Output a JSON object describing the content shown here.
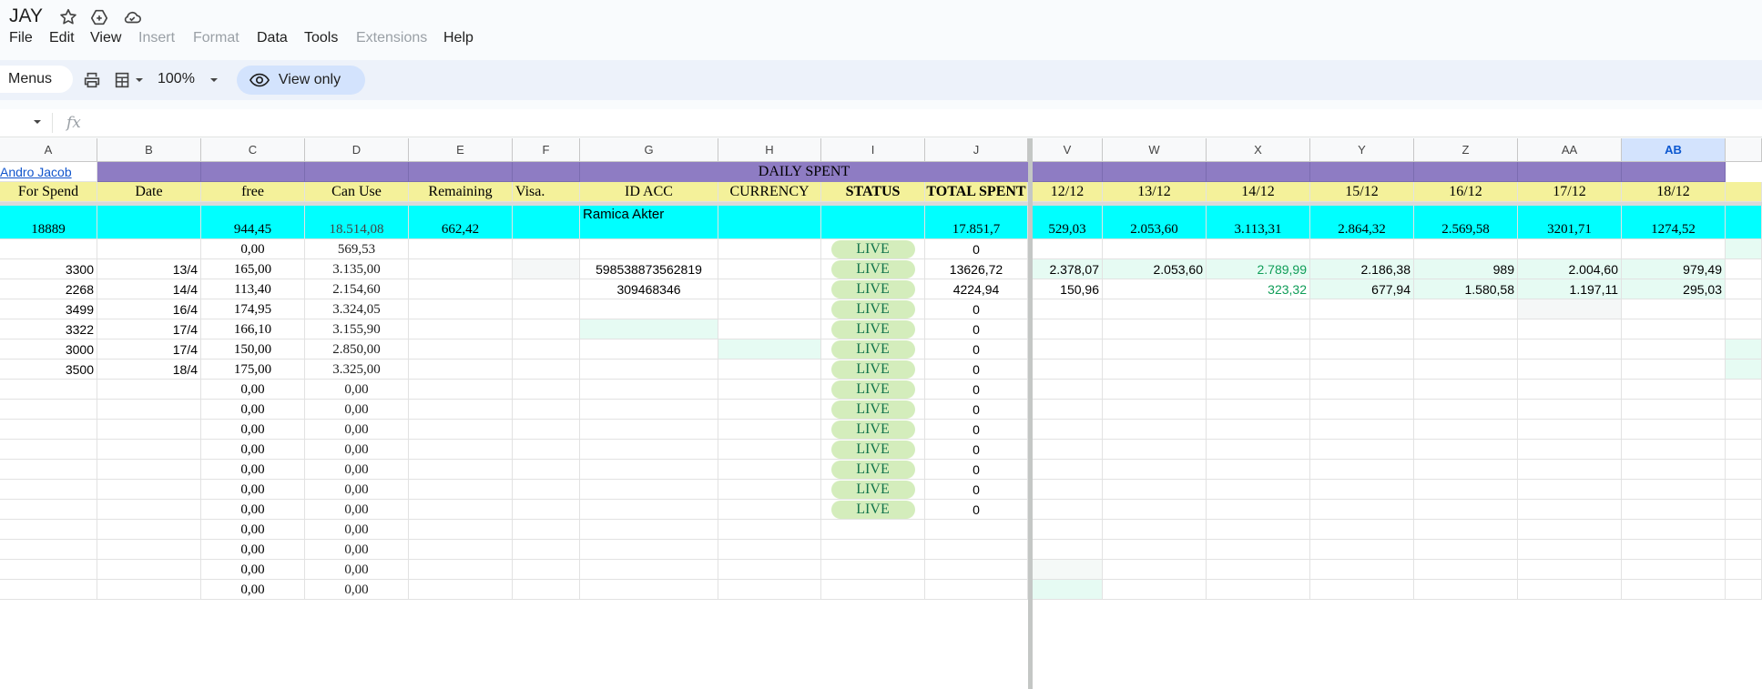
{
  "app": {
    "title": "JAY",
    "menus": [
      "File",
      "Edit",
      "View",
      "Insert",
      "Format",
      "Data",
      "Tools",
      "Extensions",
      "Help"
    ],
    "disabled_menus": [
      "Insert",
      "Format",
      "Extensions"
    ]
  },
  "toolbar": {
    "menus_label": "Menus",
    "zoom": "100%",
    "view_only_label": "View only"
  },
  "formula_bar": {
    "fx": "fx",
    "name_box": ""
  },
  "colors": {
    "purple": "#8e7cc3",
    "yellow": "#f4f19a",
    "cyan": "#00ffff",
    "mint": "#e6fbf3",
    "live_bg": "#d4edbc",
    "live_fg": "#11734b",
    "green_text": "#0f9d58"
  },
  "columns": [
    "A",
    "B",
    "C",
    "D",
    "E",
    "F",
    "G",
    "H",
    "I",
    "J",
    "V",
    "W",
    "X",
    "Y",
    "Z",
    "AA",
    "AB",
    ""
  ],
  "selected_column": "AB",
  "sheet": {
    "link_name": "Andro Jacob",
    "banner": "DAILY SPENT",
    "headers": [
      "For Spend",
      "Date",
      "free",
      "Can Use",
      "Remaining",
      "Visa.",
      "ID ACC",
      "CURRENCY",
      "STATUS",
      "TOTAL SPENT",
      "12/12",
      "13/12",
      "14/12",
      "15/12",
      "16/12",
      "17/12",
      "18/12"
    ],
    "totals": [
      "18889",
      "",
      "944,45",
      "18.514,08",
      "662,42",
      "",
      "Ramica Akter",
      "",
      "",
      "17.851,7",
      "529,03",
      "2.053,60",
      "3.113,31",
      "2.864,32",
      "2.569,58",
      "3201,71",
      "1274,52"
    ],
    "rows": [
      [
        "",
        "",
        "0,00",
        "569,53",
        "",
        "",
        "",
        "",
        "LIVE",
        "0",
        "",
        "",
        "",
        "",
        "",
        "",
        ""
      ],
      [
        "3300",
        "13/4",
        "165,00",
        "3.135,00",
        "",
        "",
        "598538873562819",
        "",
        "LIVE",
        "13626,72",
        "2.378,07",
        "2.053,60",
        "2.789,99",
        "2.186,38",
        "989",
        "2.004,60",
        "979,49"
      ],
      [
        "2268",
        "14/4",
        "113,40",
        "2.154,60",
        "",
        "",
        "309468346",
        "",
        "LIVE",
        "4224,94",
        "150,96",
        "",
        "323,32",
        "677,94",
        "1.580,58",
        "1.197,11",
        "295,03"
      ],
      [
        "3499",
        "16/4",
        "174,95",
        "3.324,05",
        "",
        "",
        "",
        "",
        "LIVE",
        "0",
        "",
        "",
        "",
        "",
        "",
        "",
        ""
      ],
      [
        "3322",
        "17/4",
        "166,10",
        "3.155,90",
        "",
        "",
        "",
        "",
        "LIVE",
        "0",
        "",
        "",
        "",
        "",
        "",
        "",
        ""
      ],
      [
        "3000",
        "17/4",
        "150,00",
        "2.850,00",
        "",
        "",
        "",
        "",
        "LIVE",
        "0",
        "",
        "",
        "",
        "",
        "",
        "",
        ""
      ],
      [
        "3500",
        "18/4",
        "175,00",
        "3.325,00",
        "",
        "",
        "",
        "",
        "LIVE",
        "0",
        "",
        "",
        "",
        "",
        "",
        "",
        ""
      ],
      [
        "",
        "",
        "0,00",
        "0,00",
        "",
        "",
        "",
        "",
        "LIVE",
        "0",
        "",
        "",
        "",
        "",
        "",
        "",
        ""
      ],
      [
        "",
        "",
        "0,00",
        "0,00",
        "",
        "",
        "",
        "",
        "LIVE",
        "0",
        "",
        "",
        "",
        "",
        "",
        "",
        ""
      ],
      [
        "",
        "",
        "0,00",
        "0,00",
        "",
        "",
        "",
        "",
        "LIVE",
        "0",
        "",
        "",
        "",
        "",
        "",
        "",
        ""
      ],
      [
        "",
        "",
        "0,00",
        "0,00",
        "",
        "",
        "",
        "",
        "LIVE",
        "0",
        "",
        "",
        "",
        "",
        "",
        "",
        ""
      ],
      [
        "",
        "",
        "0,00",
        "0,00",
        "",
        "",
        "",
        "",
        "LIVE",
        "0",
        "",
        "",
        "",
        "",
        "",
        "",
        ""
      ],
      [
        "",
        "",
        "0,00",
        "0,00",
        "",
        "",
        "",
        "",
        "LIVE",
        "0",
        "",
        "",
        "",
        "",
        "",
        "",
        ""
      ],
      [
        "",
        "",
        "0,00",
        "0,00",
        "",
        "",
        "",
        "",
        "LIVE",
        "0",
        "",
        "",
        "",
        "",
        "",
        "",
        ""
      ],
      [
        "",
        "",
        "0,00",
        "0,00",
        "",
        "",
        "",
        "",
        "",
        "",
        "",
        "",
        "",
        "",
        "",
        "",
        ""
      ],
      [
        "",
        "",
        "0,00",
        "0,00",
        "",
        "",
        "",
        "",
        "",
        "",
        "",
        "",
        "",
        "",
        "",
        "",
        ""
      ],
      [
        "",
        "",
        "0,00",
        "0,00",
        "",
        "",
        "",
        "",
        "",
        "",
        "",
        "",
        "",
        "",
        "",
        "",
        ""
      ],
      [
        "",
        "",
        "0,00",
        "0,00",
        "",
        "",
        "",
        "",
        "",
        "",
        "",
        "",
        "",
        "",
        "",
        "",
        ""
      ]
    ]
  }
}
